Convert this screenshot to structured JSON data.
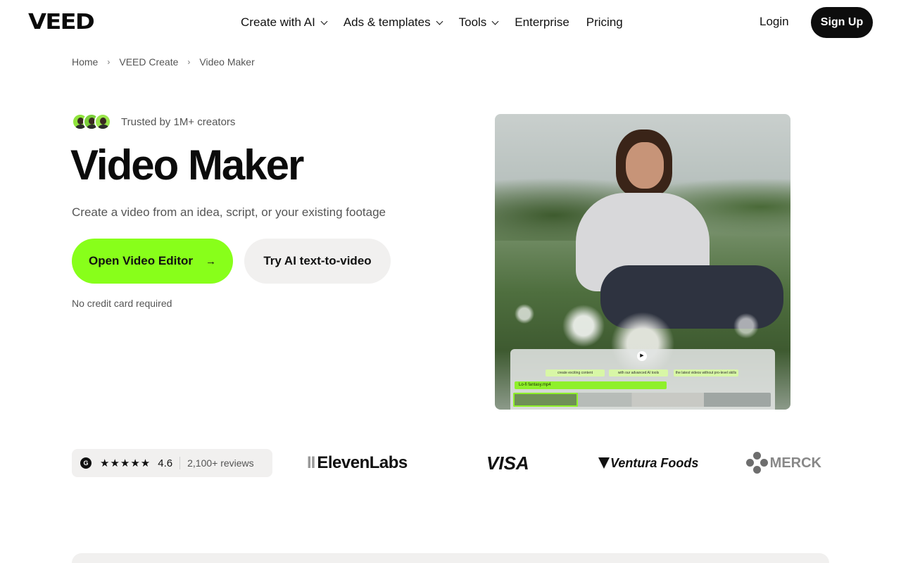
{
  "nav": {
    "logo": "VEED",
    "menu": [
      {
        "label": "Create with AI",
        "dropdown": true
      },
      {
        "label": "Ads & templates",
        "dropdown": true
      },
      {
        "label": "Tools",
        "dropdown": true
      },
      {
        "label": "Enterprise",
        "dropdown": false
      },
      {
        "label": "Pricing",
        "dropdown": false
      }
    ],
    "login": "Login",
    "signup": "Sign Up"
  },
  "breadcrumb": [
    "Home",
    "VEED Create",
    "Video Maker"
  ],
  "hero": {
    "trust_text": "Trusted by 1M+ creators",
    "title": "Video Maker",
    "subtitle": "Create a video from an idea, script, or your existing footage",
    "primary_cta": "Open Video Editor",
    "primary_cta_arrow": "→",
    "secondary_cta": "Try AI text-to-video",
    "note": "No credit card required"
  },
  "editor_preview": {
    "captions": [
      "create exciting content",
      "with our advanced AI tools",
      "the latest videos without pro-level skills"
    ],
    "track_name": "Lo-fi fantasy.mp4",
    "play_icon": "▶"
  },
  "social_proof": {
    "rating_badge": "G",
    "stars": "★★★★★",
    "score": "4.6",
    "reviews": "2,100+ reviews",
    "brands": [
      "ElevenLabs",
      "VISA",
      "Ventura Foods",
      "MERCK"
    ]
  },
  "colors": {
    "accent": "#88ff1a",
    "dark": "#0d0d0d",
    "muted_bg": "#f1f0ef"
  }
}
